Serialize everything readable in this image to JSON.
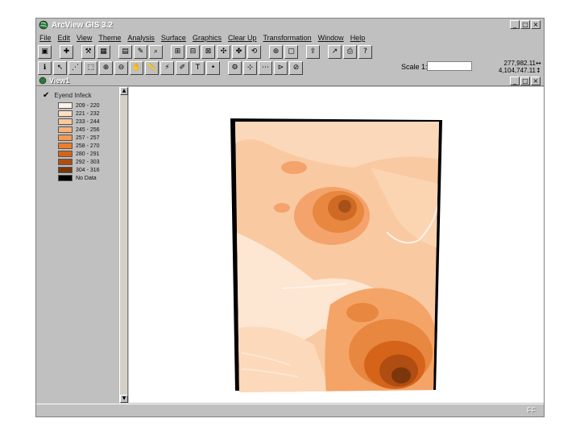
{
  "app": {
    "title": "ArcView GIS 3.2",
    "window_buttons": [
      "_",
      "□",
      "×"
    ]
  },
  "menu": [
    "File",
    "Edit",
    "View",
    "Theme",
    "Analysis",
    "Surface",
    "Graphics",
    "Clear Up",
    "Transformation",
    "Window",
    "Help"
  ],
  "toolbar1": [
    {
      "name": "save",
      "glyph": "▣"
    },
    {
      "name": "add-theme",
      "glyph": "✚"
    },
    {
      "name": "theme-properties",
      "glyph": "⚒"
    },
    {
      "name": "open-table",
      "glyph": "▦"
    },
    {
      "name": "query",
      "glyph": "▤"
    },
    {
      "name": "edit-legend",
      "glyph": "✎"
    },
    {
      "name": "find",
      "glyph": "⌕"
    },
    {
      "name": "zoom-full",
      "glyph": "⊞"
    },
    {
      "name": "zoom-active",
      "glyph": "⊟"
    },
    {
      "name": "zoom-selected",
      "glyph": "⊠"
    },
    {
      "name": "zoom-in-fixed",
      "glyph": "✣"
    },
    {
      "name": "zoom-out-fixed",
      "glyph": "✤"
    },
    {
      "name": "zoom-previous",
      "glyph": "⟲"
    },
    {
      "name": "select-features",
      "glyph": "⊛"
    },
    {
      "name": "clear-selection",
      "glyph": "▢"
    },
    {
      "name": "promote",
      "glyph": "⇪"
    },
    {
      "name": "chart",
      "glyph": "↗"
    },
    {
      "name": "layout",
      "glyph": "⎙"
    },
    {
      "name": "help",
      "glyph": "?"
    }
  ],
  "toolbar2": [
    {
      "name": "identify",
      "glyph": "ℹ"
    },
    {
      "name": "pointer",
      "glyph": "↖"
    },
    {
      "name": "vertex-edit",
      "glyph": "⋰"
    },
    {
      "name": "select-feature",
      "glyph": "⬚"
    },
    {
      "name": "zoom-in",
      "glyph": "⊕"
    },
    {
      "name": "zoom-out",
      "glyph": "⊖"
    },
    {
      "name": "pan",
      "glyph": "✋"
    },
    {
      "name": "measure",
      "glyph": "📏"
    },
    {
      "name": "hot-link",
      "glyph": "⚡"
    },
    {
      "name": "label",
      "glyph": "✐"
    },
    {
      "name": "text",
      "glyph": "T"
    },
    {
      "name": "draw-point",
      "glyph": "•"
    },
    {
      "name": "contour",
      "glyph": "⚙"
    },
    {
      "name": "spot",
      "glyph": "⊹"
    },
    {
      "name": "profile",
      "glyph": "⋯"
    },
    {
      "name": "line-of-sight",
      "glyph": "⊳"
    },
    {
      "name": "view-shed",
      "glyph": "⊘"
    }
  ],
  "scale": {
    "label": "Scale 1:",
    "value": ""
  },
  "coords": {
    "x": "277,982.11",
    "y": "4,104,747.11",
    "x_arrow": "↔",
    "y_arrow": "↕"
  },
  "view": {
    "title": "View1",
    "window_buttons": [
      "_",
      "□",
      "×"
    ]
  },
  "toc": {
    "layer_name": "Eyend Infeck",
    "visible": true,
    "legend": [
      {
        "label": "209 - 220",
        "color": "#fff2e6"
      },
      {
        "label": "221 - 232",
        "color": "#fde0c4"
      },
      {
        "label": "233 - 244",
        "color": "#fcc99d"
      },
      {
        "label": "245 - 256",
        "color": "#f9b07a"
      },
      {
        "label": "257 - 257",
        "color": "#f59a55"
      },
      {
        "label": "258 - 270",
        "color": "#ee7c2a"
      },
      {
        "label": "280 - 291",
        "color": "#d5641a"
      },
      {
        "label": "292 - 303",
        "color": "#b04d12"
      },
      {
        "label": "304 - 316",
        "color": "#7b360c"
      },
      {
        "label": "No Data",
        "color": "#000000"
      }
    ]
  },
  "status": {
    "text": "FF"
  },
  "colors": {
    "titlebar_text": "#ffffff",
    "chrome": "#c0c0c0",
    "map_background": "#ffffff"
  }
}
